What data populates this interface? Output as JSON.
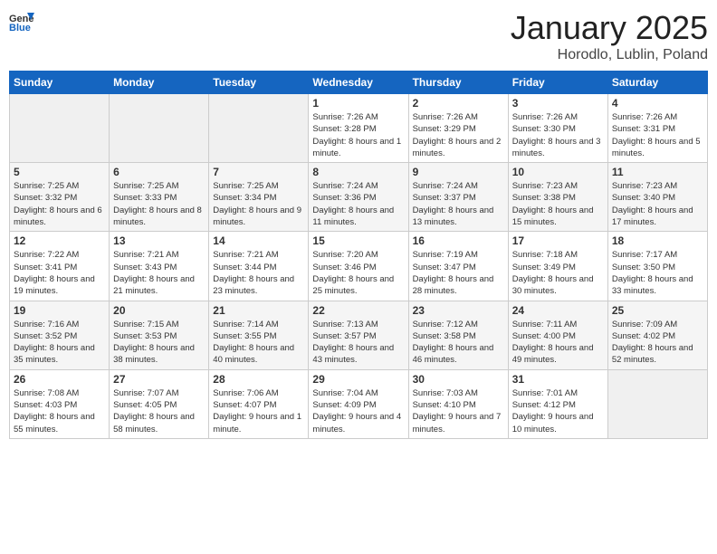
{
  "header": {
    "logo_general": "General",
    "logo_blue": "Blue",
    "month_title": "January 2025",
    "subtitle": "Horodlo, Lublin, Poland"
  },
  "weekdays": [
    "Sunday",
    "Monday",
    "Tuesday",
    "Wednesday",
    "Thursday",
    "Friday",
    "Saturday"
  ],
  "weeks": [
    [
      {
        "day": "",
        "sunrise": "",
        "sunset": "",
        "daylight": ""
      },
      {
        "day": "",
        "sunrise": "",
        "sunset": "",
        "daylight": ""
      },
      {
        "day": "",
        "sunrise": "",
        "sunset": "",
        "daylight": ""
      },
      {
        "day": "1",
        "sunrise": "Sunrise: 7:26 AM",
        "sunset": "Sunset: 3:28 PM",
        "daylight": "Daylight: 8 hours and 1 minute."
      },
      {
        "day": "2",
        "sunrise": "Sunrise: 7:26 AM",
        "sunset": "Sunset: 3:29 PM",
        "daylight": "Daylight: 8 hours and 2 minutes."
      },
      {
        "day": "3",
        "sunrise": "Sunrise: 7:26 AM",
        "sunset": "Sunset: 3:30 PM",
        "daylight": "Daylight: 8 hours and 3 minutes."
      },
      {
        "day": "4",
        "sunrise": "Sunrise: 7:26 AM",
        "sunset": "Sunset: 3:31 PM",
        "daylight": "Daylight: 8 hours and 5 minutes."
      }
    ],
    [
      {
        "day": "5",
        "sunrise": "Sunrise: 7:25 AM",
        "sunset": "Sunset: 3:32 PM",
        "daylight": "Daylight: 8 hours and 6 minutes."
      },
      {
        "day": "6",
        "sunrise": "Sunrise: 7:25 AM",
        "sunset": "Sunset: 3:33 PM",
        "daylight": "Daylight: 8 hours and 8 minutes."
      },
      {
        "day": "7",
        "sunrise": "Sunrise: 7:25 AM",
        "sunset": "Sunset: 3:34 PM",
        "daylight": "Daylight: 8 hours and 9 minutes."
      },
      {
        "day": "8",
        "sunrise": "Sunrise: 7:24 AM",
        "sunset": "Sunset: 3:36 PM",
        "daylight": "Daylight: 8 hours and 11 minutes."
      },
      {
        "day": "9",
        "sunrise": "Sunrise: 7:24 AM",
        "sunset": "Sunset: 3:37 PM",
        "daylight": "Daylight: 8 hours and 13 minutes."
      },
      {
        "day": "10",
        "sunrise": "Sunrise: 7:23 AM",
        "sunset": "Sunset: 3:38 PM",
        "daylight": "Daylight: 8 hours and 15 minutes."
      },
      {
        "day": "11",
        "sunrise": "Sunrise: 7:23 AM",
        "sunset": "Sunset: 3:40 PM",
        "daylight": "Daylight: 8 hours and 17 minutes."
      }
    ],
    [
      {
        "day": "12",
        "sunrise": "Sunrise: 7:22 AM",
        "sunset": "Sunset: 3:41 PM",
        "daylight": "Daylight: 8 hours and 19 minutes."
      },
      {
        "day": "13",
        "sunrise": "Sunrise: 7:21 AM",
        "sunset": "Sunset: 3:43 PM",
        "daylight": "Daylight: 8 hours and 21 minutes."
      },
      {
        "day": "14",
        "sunrise": "Sunrise: 7:21 AM",
        "sunset": "Sunset: 3:44 PM",
        "daylight": "Daylight: 8 hours and 23 minutes."
      },
      {
        "day": "15",
        "sunrise": "Sunrise: 7:20 AM",
        "sunset": "Sunset: 3:46 PM",
        "daylight": "Daylight: 8 hours and 25 minutes."
      },
      {
        "day": "16",
        "sunrise": "Sunrise: 7:19 AM",
        "sunset": "Sunset: 3:47 PM",
        "daylight": "Daylight: 8 hours and 28 minutes."
      },
      {
        "day": "17",
        "sunrise": "Sunrise: 7:18 AM",
        "sunset": "Sunset: 3:49 PM",
        "daylight": "Daylight: 8 hours and 30 minutes."
      },
      {
        "day": "18",
        "sunrise": "Sunrise: 7:17 AM",
        "sunset": "Sunset: 3:50 PM",
        "daylight": "Daylight: 8 hours and 33 minutes."
      }
    ],
    [
      {
        "day": "19",
        "sunrise": "Sunrise: 7:16 AM",
        "sunset": "Sunset: 3:52 PM",
        "daylight": "Daylight: 8 hours and 35 minutes."
      },
      {
        "day": "20",
        "sunrise": "Sunrise: 7:15 AM",
        "sunset": "Sunset: 3:53 PM",
        "daylight": "Daylight: 8 hours and 38 minutes."
      },
      {
        "day": "21",
        "sunrise": "Sunrise: 7:14 AM",
        "sunset": "Sunset: 3:55 PM",
        "daylight": "Daylight: 8 hours and 40 minutes."
      },
      {
        "day": "22",
        "sunrise": "Sunrise: 7:13 AM",
        "sunset": "Sunset: 3:57 PM",
        "daylight": "Daylight: 8 hours and 43 minutes."
      },
      {
        "day": "23",
        "sunrise": "Sunrise: 7:12 AM",
        "sunset": "Sunset: 3:58 PM",
        "daylight": "Daylight: 8 hours and 46 minutes."
      },
      {
        "day": "24",
        "sunrise": "Sunrise: 7:11 AM",
        "sunset": "Sunset: 4:00 PM",
        "daylight": "Daylight: 8 hours and 49 minutes."
      },
      {
        "day": "25",
        "sunrise": "Sunrise: 7:09 AM",
        "sunset": "Sunset: 4:02 PM",
        "daylight": "Daylight: 8 hours and 52 minutes."
      }
    ],
    [
      {
        "day": "26",
        "sunrise": "Sunrise: 7:08 AM",
        "sunset": "Sunset: 4:03 PM",
        "daylight": "Daylight: 8 hours and 55 minutes."
      },
      {
        "day": "27",
        "sunrise": "Sunrise: 7:07 AM",
        "sunset": "Sunset: 4:05 PM",
        "daylight": "Daylight: 8 hours and 58 minutes."
      },
      {
        "day": "28",
        "sunrise": "Sunrise: 7:06 AM",
        "sunset": "Sunset: 4:07 PM",
        "daylight": "Daylight: 9 hours and 1 minute."
      },
      {
        "day": "29",
        "sunrise": "Sunrise: 7:04 AM",
        "sunset": "Sunset: 4:09 PM",
        "daylight": "Daylight: 9 hours and 4 minutes."
      },
      {
        "day": "30",
        "sunrise": "Sunrise: 7:03 AM",
        "sunset": "Sunset: 4:10 PM",
        "daylight": "Daylight: 9 hours and 7 minutes."
      },
      {
        "day": "31",
        "sunrise": "Sunrise: 7:01 AM",
        "sunset": "Sunset: 4:12 PM",
        "daylight": "Daylight: 9 hours and 10 minutes."
      },
      {
        "day": "",
        "sunrise": "",
        "sunset": "",
        "daylight": ""
      }
    ]
  ]
}
